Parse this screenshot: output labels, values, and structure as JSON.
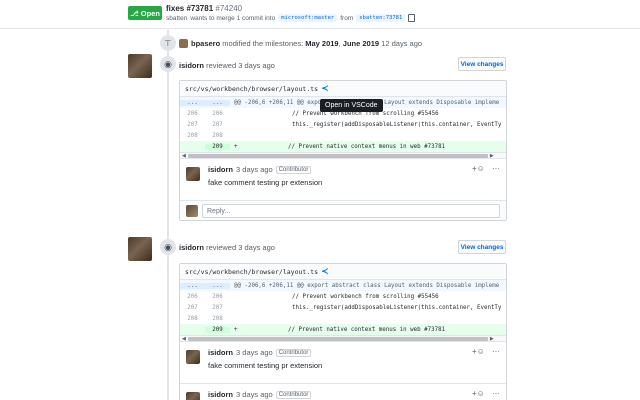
{
  "header": {
    "status": "Open",
    "title": "fixes #73781",
    "number": "#74240",
    "author": "sbatten",
    "merge_text": "wants to merge 1 commit into",
    "base_branch": "microsoft:master",
    "from_text": "from",
    "head_branch": "sbatten:73781"
  },
  "milestone_event": {
    "user": "bpasero",
    "action": "modified the milestones:",
    "milestone_a": "May 2019",
    "separator": ",",
    "milestone_b": "June 2019",
    "time": "12 days ago"
  },
  "reviews": [
    {
      "user": "isidorn",
      "action": "reviewed",
      "time": "3 days ago",
      "view_changes": "View changes",
      "file": "src/vs/workbench/browser/layout.ts",
      "tooltip": "Open in VSCode",
      "hunk": "@@ -206,6 +206,11 @@ export abstract class Layout extends Disposable impleme",
      "lines": [
        {
          "old": "206",
          "new": "206",
          "text": "// Prevent workbench from scrolling #55456",
          "type": "comment"
        },
        {
          "old": "207",
          "new": "207",
          "text": "this._register(addDisposableListener(this.container, EventTy",
          "type": "code"
        },
        {
          "old": "208",
          "new": "208",
          "text": "",
          "type": "code"
        },
        {
          "old": "",
          "new": "209",
          "text": "// Prevent native context menus in web #73781",
          "type": "add"
        }
      ],
      "comment": {
        "user": "isidorn",
        "time": "3 days ago",
        "badge": "Contributor",
        "body": "fake comment testing pr extension",
        "reply_placeholder": "Reply..."
      }
    },
    {
      "user": "isidorn",
      "action": "reviewed",
      "time": "3 days ago",
      "view_changes": "View changes",
      "file": "src/vs/workbench/browser/layout.ts",
      "hunk": "@@ -206,6 +206,11 @@ export abstract class Layout extends Disposable impleme",
      "lines": [
        {
          "old": "206",
          "new": "206",
          "text": "// Prevent workbench from scrolling #55456",
          "type": "comment"
        },
        {
          "old": "207",
          "new": "207",
          "text": "this._register(addDisposableListener(this.container, EventTy",
          "type": "code"
        },
        {
          "old": "208",
          "new": "208",
          "text": "",
          "type": "code"
        },
        {
          "old": "",
          "new": "209",
          "text": "// Prevent native context menus in web #73781",
          "type": "add"
        }
      ],
      "comment": {
        "user": "isidorn",
        "time": "3 days ago",
        "badge": "Contributor",
        "body": "fake comment testing pr extension"
      },
      "comment2": {
        "user": "isidorn",
        "time": "3 days ago",
        "badge": "Contributor"
      }
    }
  ]
}
